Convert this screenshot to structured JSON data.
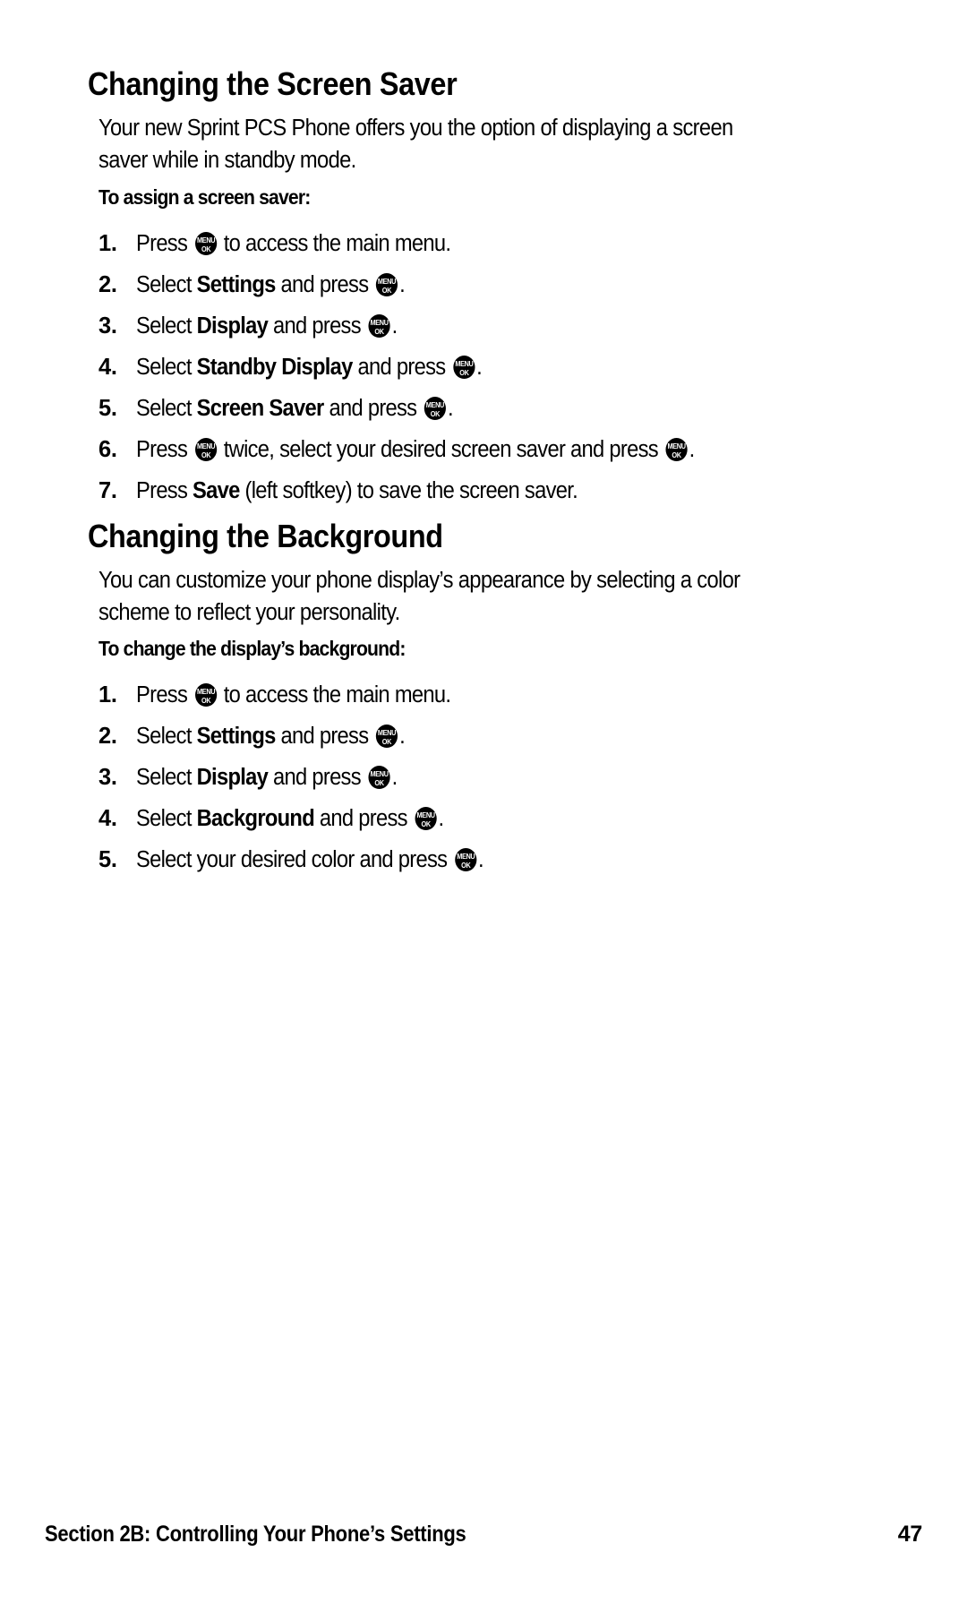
{
  "page": {
    "number": "47",
    "footer_section": "Section 2B: Controlling Your Phone’s Settings"
  },
  "icons": {
    "menu_ok": {
      "top": "MENU",
      "bottom": "OK"
    }
  },
  "sections": [
    {
      "heading": "Changing the Screen Saver",
      "intro": "Your new Sprint PCS Phone offers you the option of displaying a screen saver while in standby mode.",
      "intro_line1": "Your new Sprint PCS Phone offers you the option of displaying a screen",
      "intro_line2": "saver while in standby mode.",
      "subheading": "To assign a screen saver:",
      "steps": [
        {
          "num": "1.",
          "pre": "Press ",
          "icon": true,
          "mid": " to access the main menu.",
          "bold": "",
          "post": ""
        },
        {
          "num": "2.",
          "pre": "Select ",
          "bold": "Settings",
          "mid": " and press ",
          "icon": true,
          "post": "."
        },
        {
          "num": "3.",
          "pre": "Select ",
          "bold": "Display",
          "mid": " and press ",
          "icon": true,
          "post": "."
        },
        {
          "num": "4.",
          "pre": "Select ",
          "bold": "Standby Display",
          "mid": " and press ",
          "icon": true,
          "post": "."
        },
        {
          "num": "5.",
          "pre": "Select ",
          "bold": "Screen Saver",
          "mid": " and press ",
          "icon": true,
          "post": "."
        },
        {
          "num": "6.",
          "pre": "Press ",
          "icon": true,
          "mid": " twice, select your desired screen saver and press ",
          "icon2": true,
          "post": "."
        },
        {
          "num": "7.",
          "pre": "Press ",
          "bold": "Save",
          "mid": " (left softkey) to save the screen saver.",
          "post": ""
        }
      ]
    },
    {
      "heading": "Changing the Background",
      "intro_line1": "You can customize your phone display’s appearance by selecting a color",
      "intro_line2": "scheme to reflect your personality.",
      "subheading": "To change the display’s background:",
      "steps": [
        {
          "num": "1.",
          "pre": "Press ",
          "icon": true,
          "mid": " to access the main menu.",
          "bold": "",
          "post": ""
        },
        {
          "num": "2.",
          "pre": "Select ",
          "bold": "Settings",
          "mid": " and press ",
          "icon": true,
          "post": "."
        },
        {
          "num": "3.",
          "pre": "Select ",
          "bold": "Display",
          "mid": " and press ",
          "icon": true,
          "post": "."
        },
        {
          "num": "4.",
          "pre": "Select ",
          "bold": "Background",
          "mid": " and press ",
          "icon": true,
          "post": "."
        },
        {
          "num": "5.",
          "pre": "Select your desired color and press ",
          "icon": true,
          "bold": "",
          "mid": "",
          "post": "."
        }
      ]
    }
  ],
  "colors": {
    "text": "#000000",
    "background": "#ffffff",
    "icon_fill": "#000000",
    "icon_label": "#ffffff"
  }
}
